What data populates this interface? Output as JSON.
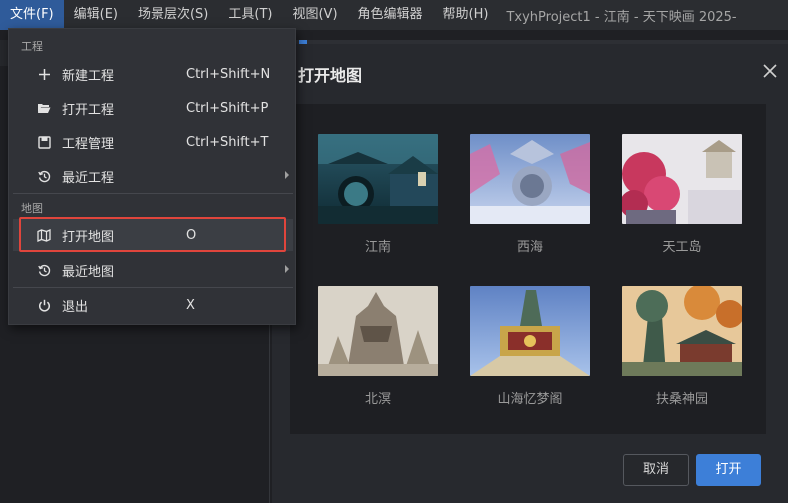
{
  "menubar": {
    "items": [
      {
        "label": "文件(F)",
        "active": true
      },
      {
        "label": "编辑(E)"
      },
      {
        "label": "场景层次(S)"
      },
      {
        "label": "工具(T)"
      },
      {
        "label": "视图(V)"
      },
      {
        "label": "角色编辑器"
      },
      {
        "label": "帮助(H)"
      }
    ],
    "window_title": "TxyhProject1 - 江南 - 天下映画 2025-"
  },
  "file_menu": {
    "section_project": "工程",
    "section_map": "地图",
    "items": [
      {
        "label": "新建工程",
        "shortcut": "Ctrl+Shift+N",
        "icon": "plus-icon"
      },
      {
        "label": "打开工程",
        "shortcut": "Ctrl+Shift+P",
        "icon": "folder-open-icon"
      },
      {
        "label": "工程管理",
        "shortcut": "Ctrl+Shift+T",
        "icon": "save-icon"
      },
      {
        "label": "最近工程",
        "shortcut": "",
        "icon": "history-icon",
        "submenu": true
      },
      {
        "label": "打开地图",
        "shortcut": "O",
        "icon": "map-icon",
        "highlighted": true
      },
      {
        "label": "最近地图",
        "shortcut": "",
        "icon": "history-icon",
        "submenu": true
      },
      {
        "label": "退出",
        "shortcut": "X",
        "icon": "power-icon"
      }
    ]
  },
  "dialog": {
    "title": "打开地图",
    "maps": [
      {
        "name": "江南"
      },
      {
        "name": "西海"
      },
      {
        "name": "天工岛"
      },
      {
        "name": "北溟"
      },
      {
        "name": "山海忆梦阁"
      },
      {
        "name": "扶桑神园"
      }
    ],
    "cancel_label": "取消",
    "open_label": "打开"
  },
  "colors": {
    "accent": "#3d7fd8",
    "highlight_box": "#e0453c",
    "menu_active": "#2f5b9a"
  }
}
